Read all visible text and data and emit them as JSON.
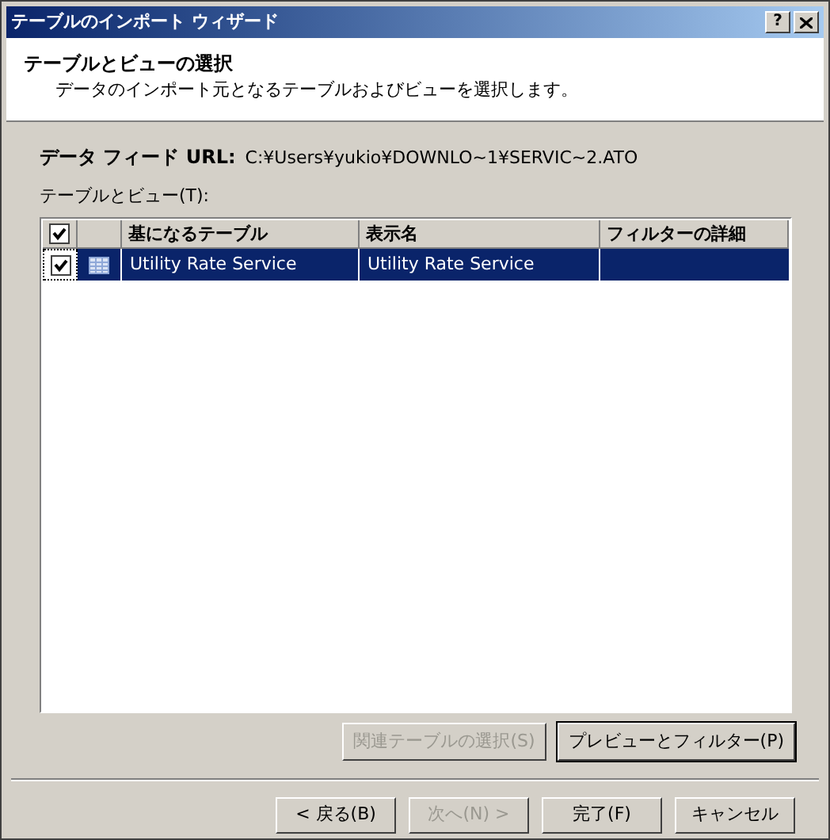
{
  "window": {
    "title": "テーブルのインポート ウィザード",
    "help": "?"
  },
  "header": {
    "title": "テーブルとビューの選択",
    "subtitle": "データのインポート元となるテーブルおよびビューを選択します。"
  },
  "feed_url": {
    "label": "データ フィード URL:",
    "value": "C:¥Users¥yukio¥DOWNLO~1¥SERVIC~2.ATO"
  },
  "list_label": "テーブルとビュー(T):",
  "table": {
    "all_checked": true,
    "columns": [
      "基になるテーブル",
      "表示名",
      "フィルターの詳細"
    ],
    "rows": [
      {
        "checked": true,
        "selected": true,
        "source": "Utility Rate Service",
        "display_name": "Utility Rate Service"
      }
    ]
  },
  "actions": [
    {
      "label": "関連テーブルの選択(S)",
      "disabled": true,
      "default": false
    },
    {
      "label": "プレビューとフィルター(P)",
      "disabled": false,
      "default": true
    }
  ],
  "footer_buttons": [
    {
      "label": "< 戻る(B)",
      "disabled": false
    },
    {
      "label": "次へ(N) >",
      "disabled": true
    },
    {
      "label": "完了(F)",
      "disabled": false
    },
    {
      "label": "キャンセル",
      "disabled": false
    }
  ]
}
